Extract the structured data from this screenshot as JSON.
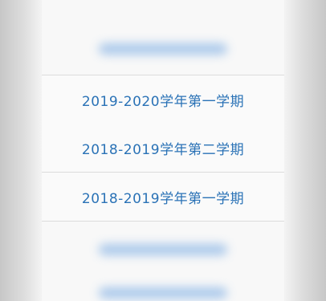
{
  "term_picker": {
    "options": [
      {
        "label": "2019-2020学年第一学期"
      },
      {
        "label": "2018-2019学年第二学期"
      },
      {
        "label": "2018-2019学年第一学期"
      }
    ]
  },
  "colors": {
    "option_text": "#2a72b6",
    "divider": "#dcdcdc",
    "background": "#f8f8f8"
  }
}
